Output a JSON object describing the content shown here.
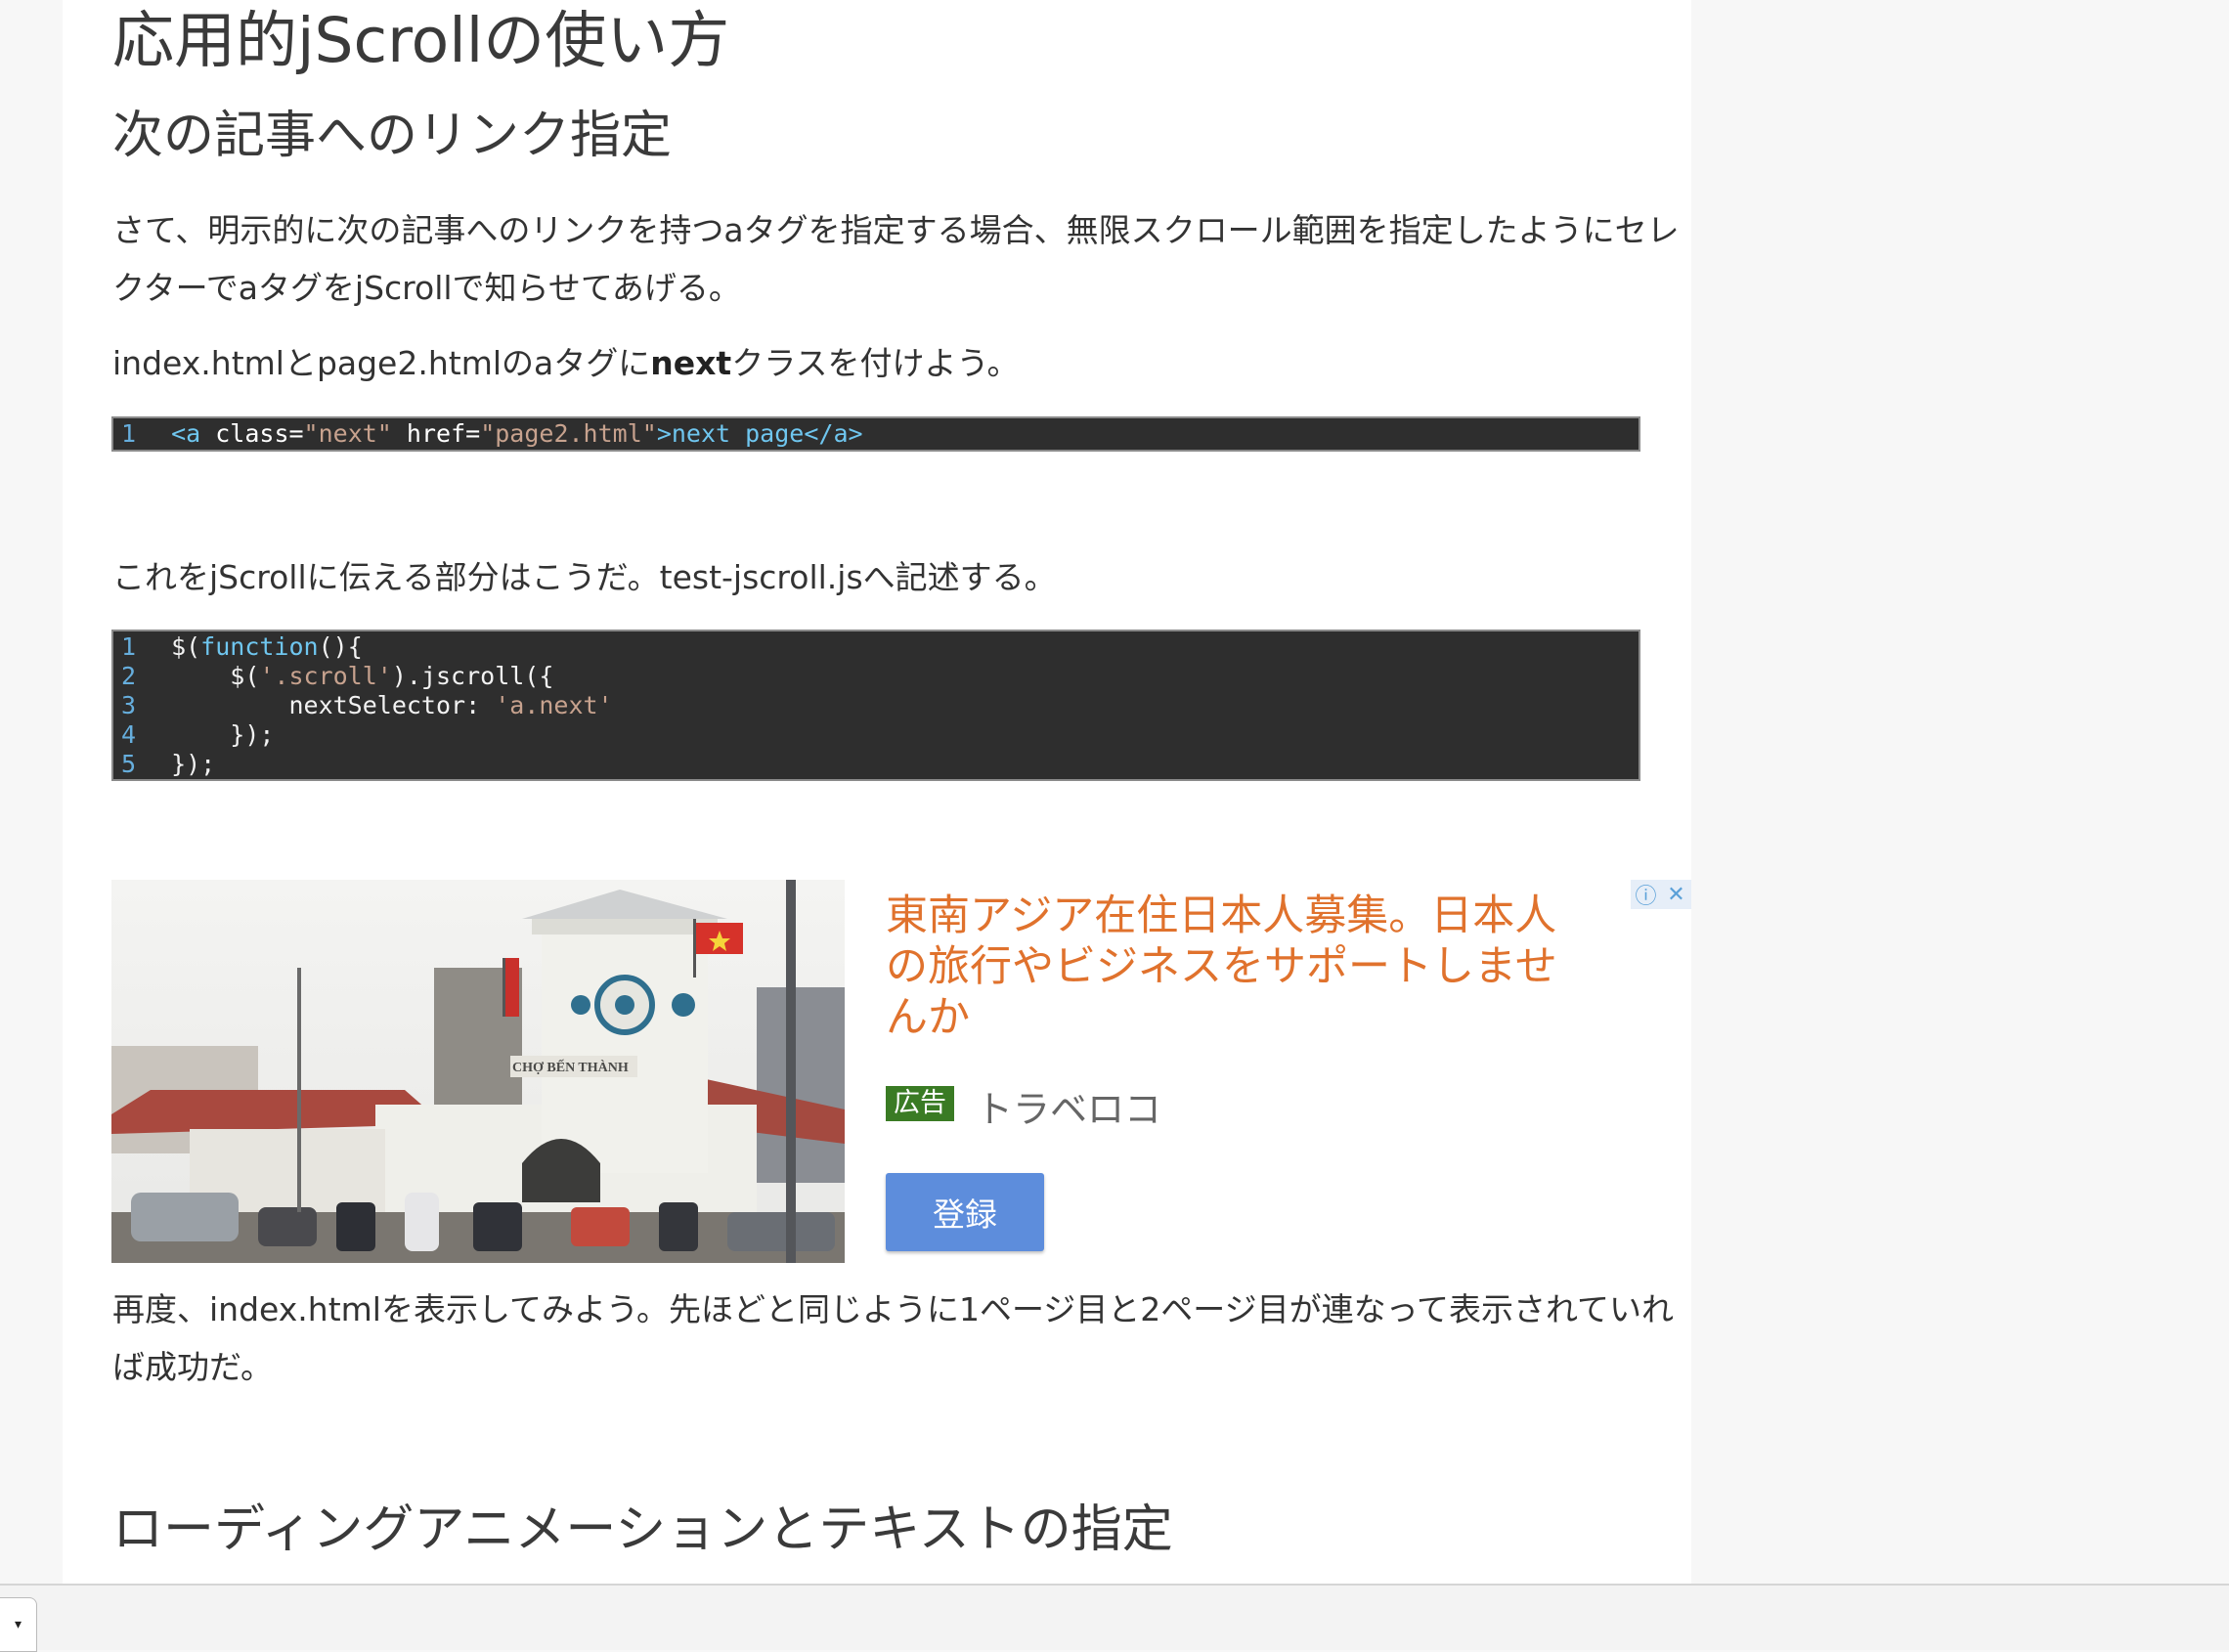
{
  "article": {
    "title": "応用的jScrollの使い方",
    "section1_heading": "次の記事へのリンク指定",
    "para1": "さて、明示的に次の記事へのリンクを持つaタグを指定する場合、無限スクロール範囲を指定したようにセレクターでaタグをjScrollで知らせてあげる。",
    "para2_before": "index.htmlとpage2.htmlのaタグに",
    "para2_bold": "next",
    "para2_after": "クラスを付けよう。",
    "code1": {
      "line_numbers": [
        "1"
      ],
      "tokens": {
        "open_tag": "<a",
        "attr_class": "class=",
        "val_class": "\"next\"",
        "attr_href": "href=",
        "val_href": "\"page2.html\"",
        "gt": ">",
        "text": "next page",
        "close_tag": "</a>"
      }
    },
    "para3": "これをjScrollに伝える部分はこうだ。test-jscroll.jsへ記述する。",
    "code2": {
      "line_numbers": [
        "1",
        "2",
        "3",
        "4",
        "5"
      ],
      "line1_a": "$(",
      "line1_kw": "function",
      "line1_b": "(){",
      "line2_a": "    $(",
      "line2_str": "'.scroll'",
      "line2_b": ").jscroll({",
      "line3_a": "        nextSelector: ",
      "line3_str": "'a.next'",
      "line4": "    });",
      "line5": "});"
    },
    "para4": "再度、index.htmlを表示してみよう。先ほどと同じように1ページ目と2ページ目が連なって表示されていれば成功だ。",
    "section2_heading": "ローディングアニメーションとテキストの指定"
  },
  "ad": {
    "headline": "東南アジア在住日本人募集。日本人の旅行やビジネスをサポートしませんか",
    "badge": "広告",
    "advertiser": "トラベロコ",
    "cta": "登録",
    "image_sign": "CHỢ BẾN THÀNH",
    "info_glyph": "ⓘ",
    "close_glyph": "✕"
  },
  "bottom_bar": {
    "dropdown_glyph": "▾"
  }
}
